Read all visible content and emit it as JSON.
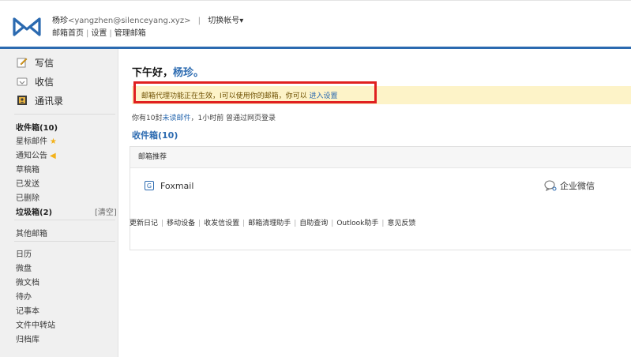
{
  "header": {
    "user_name": "杨珍",
    "user_email": "<yangzhen@silenceyang.xyz>",
    "separator": "|",
    "switch_account": "切换帐号▾",
    "links": [
      "邮箱首页",
      "设置",
      "管理邮箱"
    ],
    "link_separator": "|"
  },
  "sidebar": {
    "actions": [
      {
        "label": "写信",
        "icon": "compose-icon"
      },
      {
        "label": "收信",
        "icon": "inbox-receive-icon"
      },
      {
        "label": "通讯录",
        "icon": "contacts-icon"
      }
    ],
    "folders": [
      {
        "label": "收件箱(10)",
        "bold": true
      },
      {
        "label": "星标邮件",
        "badge": "★"
      },
      {
        "label": "通知公告",
        "badge": "◀"
      },
      {
        "label": "草稿箱"
      },
      {
        "label": "已发送"
      },
      {
        "label": "已删除"
      },
      {
        "label": "垃圾箱(2)",
        "bold": true
      }
    ],
    "clear_label": "[清空]",
    "other_mailbox": "其他邮箱",
    "tools": [
      "日历",
      "微盘",
      "微文档",
      "待办",
      "记事本",
      "文件中转站",
      "归档库"
    ]
  },
  "main": {
    "greeting_prefix": "下午好，",
    "greeting_name": "杨珍。",
    "notice": {
      "text": "邮箱代理功能正在生效，I可以使用你的邮箱，你可以 ",
      "link": "进入设置"
    },
    "unread": {
      "prefix": "你有10封",
      "link": "未读邮件",
      "suffix": "，1小时前 曾通过网页登录"
    },
    "inbox_link": "收件箱(10)",
    "recommend": {
      "title": "邮箱推荐",
      "foxmail": "Foxmail",
      "wework": "企业微信"
    },
    "footer_links": [
      "更新日记",
      "移动设备",
      "收发信设置",
      "邮箱清理助手",
      "自助查询",
      "Outlook助手",
      "意见反馈"
    ],
    "footer_separator": "|"
  },
  "colors": {
    "accent": "#2b6ab0",
    "notice_bg": "#fdf3c8",
    "highlight_border": "#e02020",
    "sidebar_bg": "#f0f0f0"
  }
}
